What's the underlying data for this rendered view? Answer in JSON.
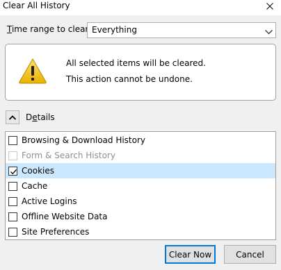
{
  "window": {
    "title": "Clear All History"
  },
  "time_range": {
    "label": "Time range to clear:",
    "accesskey": "T",
    "label_rest": "ime range to clear:",
    "selected": "Everything"
  },
  "warning": {
    "line1": "All selected items will be cleared.",
    "line2": "This action cannot be undone.",
    "icon": "warning-triangle-icon"
  },
  "details": {
    "label": "Details",
    "accesskey": "e",
    "label_pre": "D",
    "label_rest": "tails",
    "expanded": true
  },
  "items": [
    {
      "label": "Browsing & Download History",
      "checked": false,
      "disabled": false,
      "selected": false
    },
    {
      "label": "Form & Search History",
      "checked": false,
      "disabled": true,
      "selected": false
    },
    {
      "label": "Cookies",
      "checked": true,
      "disabled": false,
      "selected": true
    },
    {
      "label": "Cache",
      "checked": false,
      "disabled": false,
      "selected": false
    },
    {
      "label": "Active Logins",
      "checked": false,
      "disabled": false,
      "selected": false
    },
    {
      "label": "Offline Website Data",
      "checked": false,
      "disabled": false,
      "selected": false
    },
    {
      "label": "Site Preferences",
      "checked": false,
      "disabled": false,
      "selected": false
    }
  ],
  "buttons": {
    "clear_now": "Clear Now",
    "cancel": "Cancel"
  },
  "colors": {
    "accent": "#0078d7",
    "selection": "#cce8ff",
    "warning_fill": "#f2c500"
  }
}
